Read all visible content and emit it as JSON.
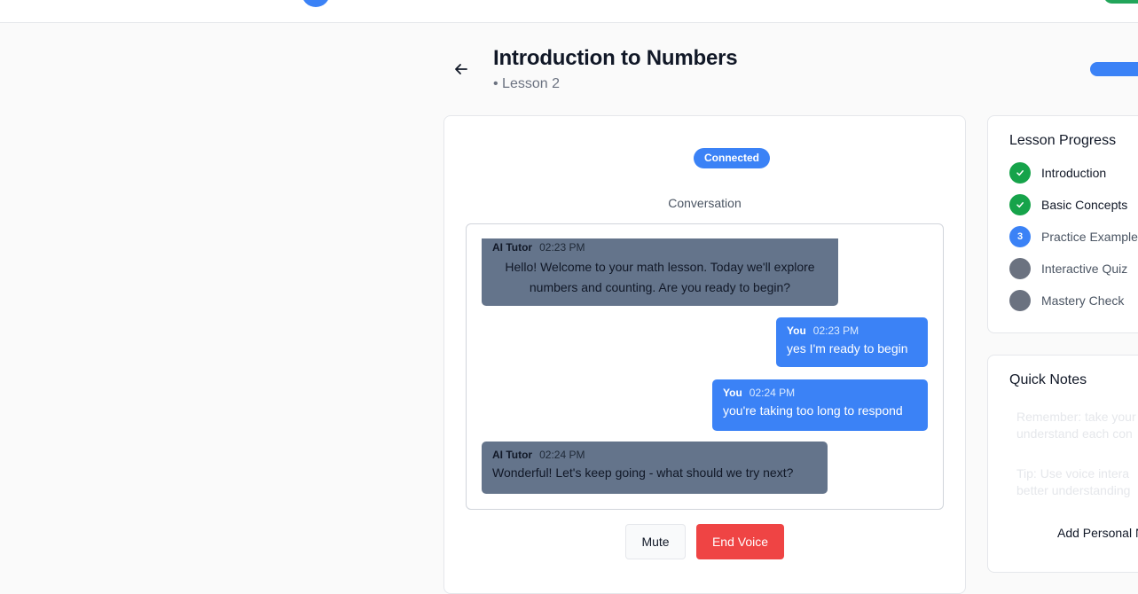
{
  "header": {
    "title": "Introduction to Numbers",
    "subtitle": "• Lesson 2"
  },
  "voice": {
    "status": "Connected",
    "conversation_label": "Conversation",
    "messages": [
      {
        "sender": "AI Tutor",
        "time": "02:23 PM",
        "text": "Hello! Welcome to your math lesson. Today we'll explore numbers and counting. Are you ready to begin?"
      },
      {
        "sender": "You",
        "time": "02:23 PM",
        "text": "yes I'm ready to begin"
      },
      {
        "sender": "You",
        "time": "02:24 PM",
        "text": "you're taking too long to respond"
      },
      {
        "sender": "AI Tutor",
        "time": "02:24 PM",
        "text": "Wonderful! Let's keep going - what should we try next?"
      }
    ],
    "mute_label": "Mute",
    "end_label": "End Voice"
  },
  "progress": {
    "title": "Lesson Progress",
    "steps": [
      {
        "label": "Introduction",
        "state": "complete"
      },
      {
        "label": "Basic Concepts",
        "state": "complete"
      },
      {
        "label": "Practice Examples",
        "state": "current",
        "number": "3"
      },
      {
        "label": "Interactive Quiz",
        "state": "locked"
      },
      {
        "label": "Mastery Check",
        "state": "locked"
      }
    ]
  },
  "notes": {
    "title": "Quick Notes",
    "items": [
      {
        "line1": "Remember: take your",
        "line2": "understand each con"
      },
      {
        "line1": "Tip: Use voice intera",
        "line2": "better understanding"
      }
    ],
    "add_label": "Add Personal Note"
  },
  "colors": {
    "accent": "#3b82f6",
    "success": "#16a34a",
    "danger": "#ef4444",
    "tutor_bubble": "#64748b"
  }
}
